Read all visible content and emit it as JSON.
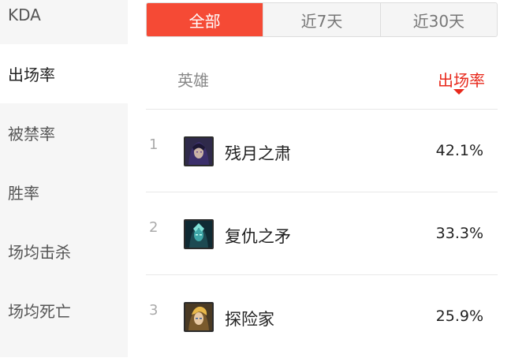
{
  "sidebar": {
    "items": [
      {
        "label": "KDA"
      },
      {
        "label": "出场率",
        "active": true
      },
      {
        "label": "被禁率"
      },
      {
        "label": "胜率"
      },
      {
        "label": "场均击杀"
      },
      {
        "label": "场均死亡"
      }
    ]
  },
  "tabs": [
    {
      "label": "全部",
      "active": true
    },
    {
      "label": "近7天"
    },
    {
      "label": "近30天"
    }
  ],
  "table": {
    "col_hero": "英雄",
    "col_rate": "出场率",
    "rows": [
      {
        "rank": "1",
        "name": "残月之肃",
        "rate": "42.1%",
        "avatar": "hero-portrait"
      },
      {
        "rank": "2",
        "name": "复仇之矛",
        "rate": "33.3%",
        "avatar": "hero-portrait"
      },
      {
        "rank": "3",
        "name": "探险家",
        "rate": "25.9%",
        "avatar": "hero-portrait"
      }
    ]
  },
  "colors": {
    "accent": "#f54a35",
    "sort_active": "#e8291c"
  }
}
